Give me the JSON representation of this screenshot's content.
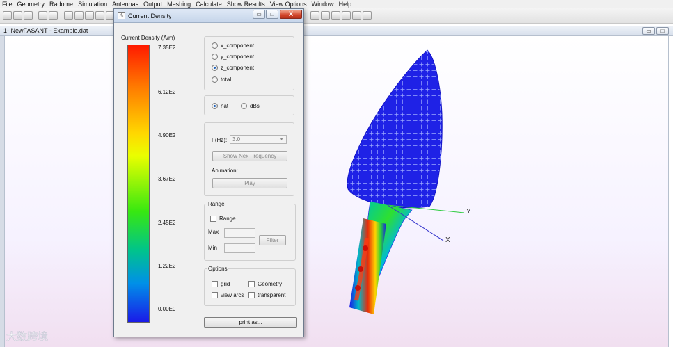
{
  "menubar": {
    "items": [
      "File",
      "Geometry",
      "Radome",
      "Simulation",
      "Antennas",
      "Output",
      "Meshing",
      "Calculate",
      "Show Results",
      "View Options",
      "Window",
      "Help"
    ]
  },
  "document": {
    "title": "1- NewFASANT - Example.dat",
    "restore_glyph": "▭",
    "maximize_glyph": "□"
  },
  "viewport": {
    "axis_y": "Y",
    "axis_x": "X",
    "accent_mesh": "#2222ee",
    "axis_color": "#3333cc"
  },
  "dialog": {
    "title": "Current Density",
    "icon_glyph": "⚠",
    "minimize_glyph": "▭",
    "maximize_glyph": "□",
    "close_glyph": "X",
    "close_color": "#c8391f"
  },
  "scale": {
    "title": "Current Density (A/m)",
    "labels": [
      "7.35E2",
      "6.12E2",
      "4.90E2",
      "3.67E2",
      "2.45E2",
      "1.22E2",
      "0.00E0"
    ]
  },
  "component": {
    "options": [
      "x_component",
      "y_component",
      "z_component",
      "total"
    ],
    "selected": "z_component"
  },
  "units": {
    "options": [
      "nat",
      "dBs"
    ],
    "selected": "nat"
  },
  "frequency": {
    "label": "F(Hz):",
    "value": "3.0",
    "next_button": "Show Nex Frequency",
    "animation_label": "Animation:",
    "play_button": "Play"
  },
  "range": {
    "title": "Range",
    "checkbox": "Range",
    "max_label": "Max",
    "min_label": "Min",
    "filter_button": "Filter"
  },
  "options": {
    "title": "Options",
    "grid": "grid",
    "geometry": "Geometry",
    "view_arcs": "view arcs",
    "transparent": "transparent"
  },
  "print_button": "print as...",
  "watermark": "大数跨境"
}
